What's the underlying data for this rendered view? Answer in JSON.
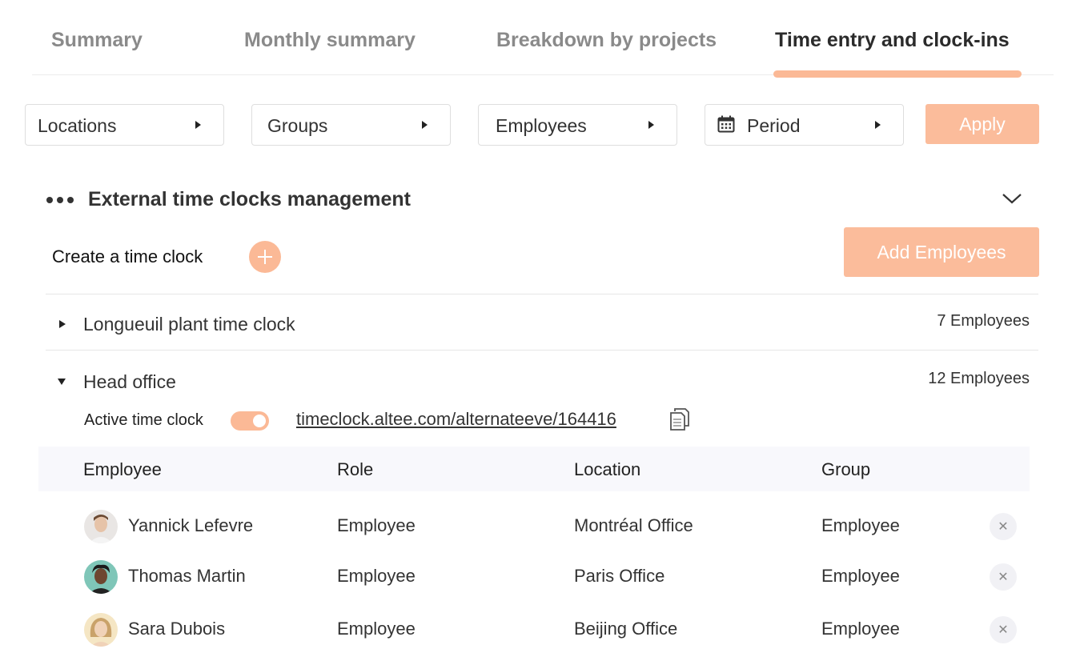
{
  "tabs": [
    {
      "label": "Summary"
    },
    {
      "label": "Monthly summary"
    },
    {
      "label": "Breakdown by projects"
    },
    {
      "label": "Time entry and clock-ins"
    }
  ],
  "active_tab": 3,
  "filters": {
    "locations": "Locations",
    "groups": "Groups",
    "employees": "Employees",
    "period": "Period",
    "apply": "Apply"
  },
  "section": {
    "title": "External time clocks management",
    "create_label": "Create a time clock",
    "add_employees": "Add Employees"
  },
  "time_clocks": [
    {
      "name": "Longueuil plant time clock",
      "count": "7 Employees",
      "expanded": false
    },
    {
      "name": "Head office",
      "count": "12 Employees",
      "expanded": true
    }
  ],
  "head_office": {
    "active_label": "Active time clock",
    "active": true,
    "url": "timeclock.altee.com/alternateeve/164416"
  },
  "table": {
    "headers": [
      "Employee",
      "Role",
      "Location",
      "Group"
    ],
    "rows": [
      {
        "name": "Yannick Lefevre",
        "role": "Employee",
        "location": "Montréal Office",
        "group": "Employee"
      },
      {
        "name": "Thomas  Martin",
        "role": "Employee",
        "location": "Paris Office",
        "group": "Employee"
      },
      {
        "name": "Sara Dubois",
        "role": "Employee",
        "location": "Beijing Office",
        "group": "Employee"
      }
    ],
    "remove_symbol": "✕"
  },
  "colors": {
    "accent": "#fbb996",
    "accent_button": "#fbbc9b",
    "header_bg": "#f8f8fc"
  },
  "icons": [
    "calendar-icon",
    "chevron-down-icon",
    "plus-icon",
    "copy-icon",
    "close-icon",
    "more-dots-icon"
  ]
}
